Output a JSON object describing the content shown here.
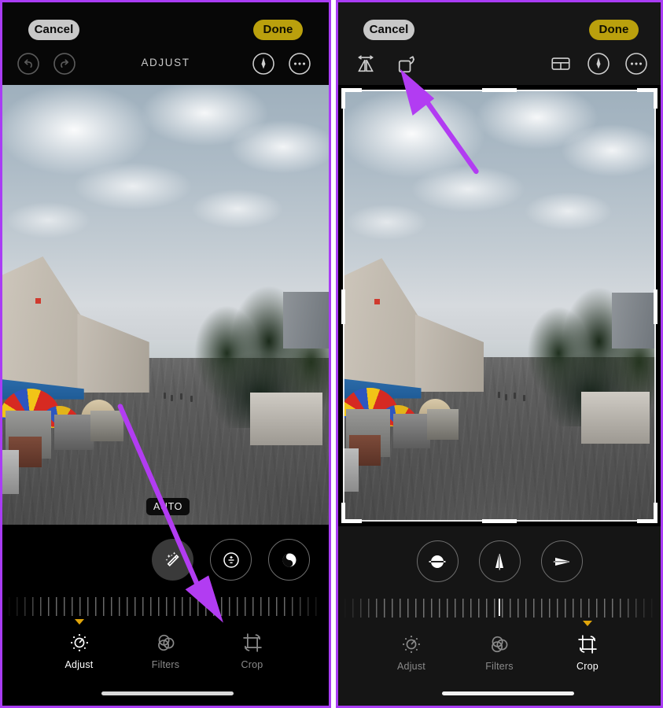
{
  "meta": {
    "accent_purple": "#a93cf5",
    "done_button_color": "#baa00d",
    "cancel_button_color": "#c8c8c8",
    "marker_yellow": "#e0a50b",
    "panel_background": "#000000"
  },
  "panels": [
    {
      "id": "adjust-panel",
      "header": {
        "cancel_label": "Cancel",
        "done_label": "Done",
        "title": "ADJUST",
        "left_icons": [
          {
            "name": "undo-icon",
            "label": "Undo"
          },
          {
            "name": "redo-icon",
            "label": "Redo"
          }
        ],
        "right_icons": [
          {
            "name": "markup-pen-icon",
            "label": "Markup"
          },
          {
            "name": "more-options-icon",
            "label": "More"
          }
        ]
      },
      "photo": {
        "badge": "AUTO",
        "description": "Street scene with market stalls, colorful umbrellas and trees"
      },
      "controls": {
        "circle_buttons": [
          {
            "name": "auto-enhance-button",
            "label": "Auto Enhance",
            "active": true
          },
          {
            "name": "exposure-button",
            "label": "Exposure",
            "active": false
          },
          {
            "name": "brilliance-button",
            "label": "Brilliance",
            "active": false
          }
        ],
        "slider": {
          "name": "intensity-slider",
          "value": "",
          "centered": false
        }
      },
      "tabs": [
        {
          "name": "tab-adjust",
          "label": "Adjust",
          "selected": true
        },
        {
          "name": "tab-filters",
          "label": "Filters",
          "selected": false
        },
        {
          "name": "tab-crop",
          "label": "Crop",
          "selected": false
        }
      ]
    },
    {
      "id": "crop-panel",
      "header": {
        "cancel_label": "Cancel",
        "done_label": "Done",
        "title": "",
        "left_icons": [
          {
            "name": "flip-horizontal-icon",
            "label": "Flip"
          },
          {
            "name": "rotate-icon",
            "label": "Rotate"
          }
        ],
        "right_icons": [
          {
            "name": "aspect-ratio-icon",
            "label": "Aspect Ratio"
          },
          {
            "name": "markup-pen-icon",
            "label": "Markup"
          },
          {
            "name": "more-options-icon",
            "label": "More"
          }
        ]
      },
      "photo": {
        "badge": "",
        "description": "Street scene with market stalls, colorful umbrellas and trees shown inside crop frame"
      },
      "controls": {
        "circle_buttons": [
          {
            "name": "straighten-button",
            "label": "Straighten",
            "active": false
          },
          {
            "name": "vertical-perspective-button",
            "label": "Vertical Perspective",
            "active": false
          },
          {
            "name": "horizontal-perspective-button",
            "label": "Horizontal Perspective",
            "active": false
          }
        ],
        "slider": {
          "name": "straighten-slider",
          "value": "0",
          "centered": true
        }
      },
      "tabs": [
        {
          "name": "tab-adjust",
          "label": "Adjust",
          "selected": false
        },
        {
          "name": "tab-filters",
          "label": "Filters",
          "selected": false
        },
        {
          "name": "tab-crop",
          "label": "Crop",
          "selected": true
        }
      ]
    }
  ],
  "annotations": [
    {
      "name": "arrow-to-crop-tab",
      "color": "#a93cf5",
      "description": "Purple arrow pointing from photo down to the Crop tab"
    },
    {
      "name": "arrow-to-rotate-icon",
      "color": "#a93cf5",
      "description": "Purple arrow pointing up to the rotate icon in the crop toolbar"
    }
  ]
}
